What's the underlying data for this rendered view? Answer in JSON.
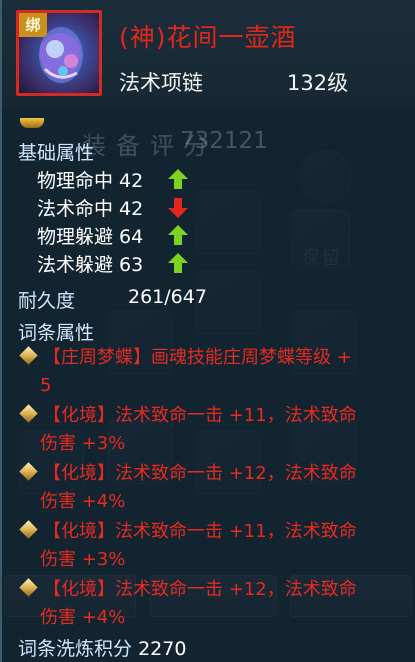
{
  "item": {
    "bound_tag": "绑",
    "name": "(神)花间一壶酒",
    "type": "法术项链",
    "level": "132级",
    "name_color": "#e2261c"
  },
  "background": {
    "score_label": "装备评分",
    "score_value": "732121",
    "save_button": "保留"
  },
  "basic": {
    "title": "基础属性",
    "stats": [
      {
        "label": "物理命中 42",
        "trend": "up",
        "icon": "green-up-arrow-icon"
      },
      {
        "label": "法术命中 42",
        "trend": "down",
        "icon": "red-down-arrow-icon"
      },
      {
        "label": "物理躲避 64",
        "trend": "up",
        "icon": "green-up-arrow-icon"
      },
      {
        "label": "法术躲避 63",
        "trend": "up",
        "icon": "green-up-arrow-icon"
      }
    ]
  },
  "durability": {
    "label": "耐久度",
    "value": "261/647"
  },
  "affixes": {
    "title": "词条属性",
    "items": [
      {
        "line1": "【庄周梦蝶】画魂技能庄周梦蝶等级 +",
        "line2": "5"
      },
      {
        "line1": "【化境】法术致命一击 +11，法术致命",
        "line2": "伤害 +3%"
      },
      {
        "line1": "【化境】法术致命一击 +12，法术致命",
        "line2": "伤害 +4%"
      },
      {
        "line1": "【化境】法术致命一击 +11，法术致命",
        "line2": "伤害 +3%"
      },
      {
        "line1": "【化境】法术致命一击 +12，法术致命",
        "line2": "伤害 +4%"
      }
    ]
  },
  "refine": {
    "label": "词条洗炼积分",
    "value": "2270"
  },
  "colors": {
    "up": "#7ed321",
    "down": "#e2261c",
    "affix": "#e52a20"
  }
}
